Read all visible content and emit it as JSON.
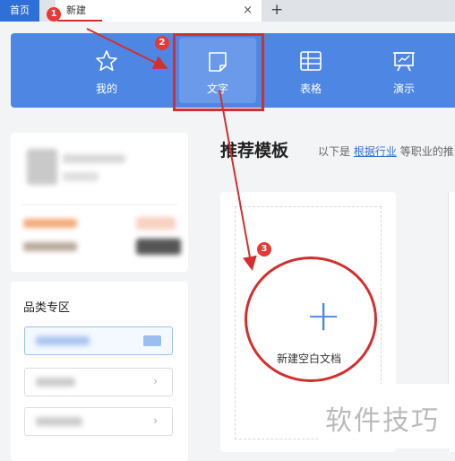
{
  "tabs": {
    "home_label": "首页",
    "new_label": "新建",
    "close_glyph": "×",
    "add_glyph": "+"
  },
  "toolbar": {
    "items": [
      {
        "label": "我的",
        "icon": "star-icon"
      },
      {
        "label": "文字",
        "icon": "document-icon",
        "active": true
      },
      {
        "label": "表格",
        "icon": "table-icon"
      },
      {
        "label": "演示",
        "icon": "presentation-icon"
      }
    ]
  },
  "annotations": {
    "steps": [
      "1",
      "2",
      "3"
    ],
    "color": "#d32f2f"
  },
  "sidebar": {
    "category_title": "品类专区",
    "chevron": "›"
  },
  "main": {
    "section_title": "推荐模板",
    "subtitle_prefix": "以下是",
    "subtitle_link": "根据行业",
    "subtitle_suffix": "等职业的推",
    "blank_doc_label": "新建空白文档",
    "plus_glyph": "+"
  },
  "watermark": {
    "text": "软件技巧"
  },
  "colors": {
    "accent": "#4e87e3",
    "tab_home": "#2f6fd8",
    "annotation": "#d32f2f"
  }
}
